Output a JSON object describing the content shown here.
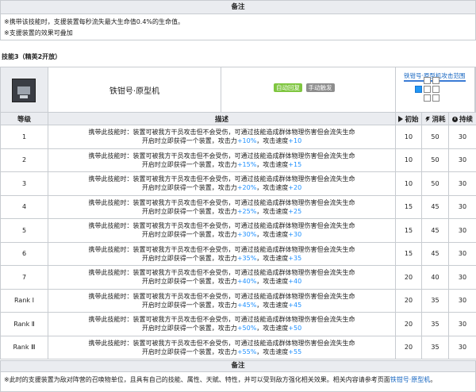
{
  "top_band": {
    "label": "备注"
  },
  "notes": [
    "※携带该技能时，支援装置每秒流失最大生命值0.4%的生命值。",
    "※支援装置的效果可叠加"
  ],
  "skill": {
    "title": "技能3（精英2开放）",
    "name": "铁钳号·原型机",
    "tags": [
      "自动回复",
      "手动触发"
    ],
    "range_title": "铁钳号·原型机攻击范围",
    "icon_name": "skill-icon"
  },
  "table": {
    "headers": {
      "level": "等级",
      "desc": "描述",
      "initial": "初始",
      "cost": "消耗",
      "duration": "持续"
    },
    "rows": [
      {
        "level": "1",
        "l1": "携带此技能时：装置可被我方干员攻击但不会受伤，可通过技能造成群体物理伤害但会流失生命",
        "l2a": "开启时立即获得一个装置，攻击力",
        "atk": "+10%",
        "l2b": "，攻击速度",
        "spd": "+10",
        "initial": "10",
        "cost": "50",
        "duration": "30"
      },
      {
        "level": "2",
        "l1": "携带此技能时：装置可被我方干员攻击但不会受伤，可通过技能造成群体物理伤害但会流失生命",
        "l2a": "开启时立即获得一个装置，攻击力",
        "atk": "+15%",
        "l2b": "，攻击速度",
        "spd": "+15",
        "initial": "10",
        "cost": "50",
        "duration": "30"
      },
      {
        "level": "3",
        "l1": "携带此技能时：装置可被我方干员攻击但不会受伤，可通过技能造成群体物理伤害但会流失生命",
        "l2a": "开启时立即获得一个装置，攻击力",
        "atk": "+20%",
        "l2b": "，攻击速度",
        "spd": "+20",
        "initial": "10",
        "cost": "50",
        "duration": "30"
      },
      {
        "level": "4",
        "l1": "携带此技能时：装置可被我方干员攻击但不会受伤，可通过技能造成群体物理伤害但会流失生命",
        "l2a": "开启时立即获得一个装置，攻击力",
        "atk": "+25%",
        "l2b": "，攻击速度",
        "spd": "+25",
        "initial": "15",
        "cost": "45",
        "duration": "30"
      },
      {
        "level": "5",
        "l1": "携带此技能时：装置可被我方干员攻击但不会受伤，可通过技能造成群体物理伤害但会流失生命",
        "l2a": "开启时立即获得一个装置，攻击力",
        "atk": "+30%",
        "l2b": "，攻击速度",
        "spd": "+30",
        "initial": "15",
        "cost": "45",
        "duration": "30"
      },
      {
        "level": "6",
        "l1": "携带此技能时：装置可被我方干员攻击但不会受伤，可通过技能造成群体物理伤害但会流失生命",
        "l2a": "开启时立即获得一个装置，攻击力",
        "atk": "+35%",
        "l2b": "，攻击速度",
        "spd": "+35",
        "initial": "15",
        "cost": "45",
        "duration": "30"
      },
      {
        "level": "7",
        "l1": "携带此技能时：装置可被我方干员攻击但不会受伤，可通过技能造成群体物理伤害但会流失生命",
        "l2a": "开启时立即获得一个装置，攻击力",
        "atk": "+40%",
        "l2b": "，攻击速度",
        "spd": "+40",
        "initial": "20",
        "cost": "40",
        "duration": "30"
      },
      {
        "level": "Rank Ⅰ",
        "l1": "携带此技能时：装置可被我方干员攻击但不会受伤，可通过技能造成群体物理伤害但会流失生命",
        "l2a": "开启时立即获得一个装置，攻击力",
        "atk": "+45%",
        "l2b": "，攻击速度",
        "spd": "+45",
        "initial": "20",
        "cost": "35",
        "duration": "30"
      },
      {
        "level": "Rank Ⅱ",
        "l1": "携带此技能时：装置可被我方干员攻击但不会受伤，可通过技能造成群体物理伤害但会流失生命",
        "l2a": "开启时立即获得一个装置，攻击力",
        "atk": "+50%",
        "l2b": "，攻击速度",
        "spd": "+50",
        "initial": "20",
        "cost": "35",
        "duration": "30"
      },
      {
        "level": "Rank Ⅲ",
        "l1": "携带此技能时：装置可被我方干员攻击但不会受伤，可通过技能造成群体物理伤害但会流失生命",
        "l2a": "开启时立即获得一个装置，攻击力",
        "atk": "+55%",
        "l2b": "，攻击速度",
        "spd": "+55",
        "initial": "20",
        "cost": "35",
        "duration": "30"
      }
    ]
  },
  "bottom_band": {
    "label": "备注"
  },
  "footer_note": {
    "text": "※此时的支援装置为敌对阵营的召唤物单位，且具有自己的技能、属性、天赋、特性，并可以受到敌方强化相关效果。相关内容请参考页面",
    "link": "铁钳号·原型机",
    "end": "。"
  },
  "colors": {
    "highlight": "#1e90ff",
    "header_bg": "#eaecf0",
    "auto_tag": "#7fc640",
    "manual_tag": "#8d8d8d",
    "range_self": "#2196f3"
  }
}
